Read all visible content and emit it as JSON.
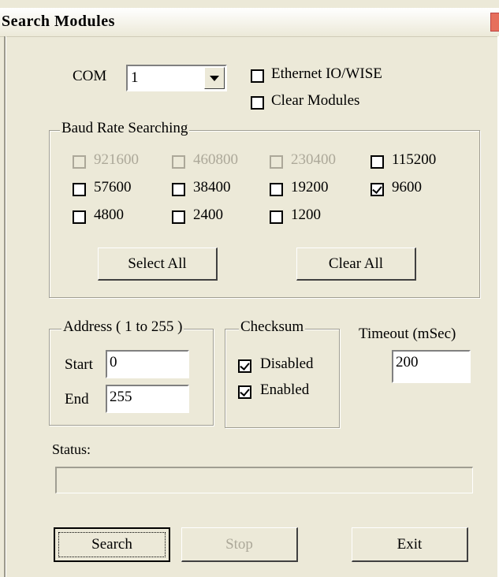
{
  "window": {
    "title": "Search Modules"
  },
  "com": {
    "label": "COM",
    "selected": "1"
  },
  "options": {
    "ethernet_label": "Ethernet IO/WISE",
    "ethernet_checked": false,
    "clear_modules_label": "Clear Modules",
    "clear_modules_checked": false
  },
  "baud": {
    "group_label": "Baud Rate Searching",
    "rates": [
      {
        "label": "921600",
        "checked": false,
        "enabled": false
      },
      {
        "label": "460800",
        "checked": false,
        "enabled": false
      },
      {
        "label": "230400",
        "checked": false,
        "enabled": false
      },
      {
        "label": "115200",
        "checked": false,
        "enabled": true
      },
      {
        "label": "57600",
        "checked": false,
        "enabled": true
      },
      {
        "label": "38400",
        "checked": false,
        "enabled": true
      },
      {
        "label": "19200",
        "checked": false,
        "enabled": true
      },
      {
        "label": "9600",
        "checked": true,
        "enabled": true
      },
      {
        "label": "4800",
        "checked": false,
        "enabled": true
      },
      {
        "label": "2400",
        "checked": false,
        "enabled": true
      },
      {
        "label": "1200",
        "checked": false,
        "enabled": true
      }
    ],
    "select_all_label": "Select All",
    "clear_all_label": "Clear All"
  },
  "address": {
    "group_label": "Address ( 1 to 255 )",
    "start_label": "Start",
    "start_value": "0",
    "end_label": "End",
    "end_value": "255"
  },
  "checksum": {
    "group_label": "Checksum",
    "disabled_label": "Disabled",
    "disabled_checked": true,
    "enabled_label": "Enabled",
    "enabled_checked": true
  },
  "timeout": {
    "label": "Timeout (mSec)",
    "value": "200"
  },
  "status": {
    "label": "Status:",
    "progress": 0
  },
  "buttons": {
    "search_label": "Search",
    "stop_label": "Stop",
    "exit_label": "Exit"
  }
}
